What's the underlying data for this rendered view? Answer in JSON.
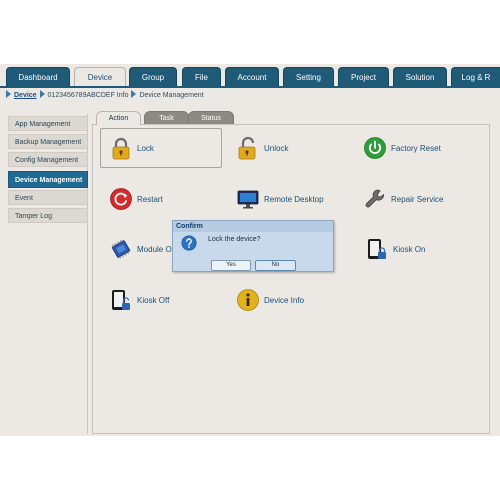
{
  "nav": {
    "tabs": [
      {
        "label": "Dashboard",
        "active": false
      },
      {
        "label": "Device",
        "active": true
      },
      {
        "label": "Group",
        "active": false
      },
      {
        "label": "File",
        "active": false
      },
      {
        "label": "Account",
        "active": false
      },
      {
        "label": "Setting",
        "active": false
      },
      {
        "label": "Project",
        "active": false
      },
      {
        "label": "Solution",
        "active": false
      },
      {
        "label": "Log & R",
        "active": false
      }
    ]
  },
  "breadcrumb": {
    "items": [
      "Device",
      "0123456789ABCDEF Info",
      "Device Management"
    ]
  },
  "sidebar": {
    "items": [
      {
        "label": "App Management",
        "active": false
      },
      {
        "label": "Backup Management",
        "active": false
      },
      {
        "label": "Config Management",
        "active": false
      },
      {
        "label": "Device Management",
        "active": true
      },
      {
        "label": "Event",
        "active": false
      },
      {
        "label": "Tamper Log",
        "active": false
      }
    ]
  },
  "subtabs": [
    {
      "label": "Action",
      "active": true
    },
    {
      "label": "Task",
      "active": false
    },
    {
      "label": "Status",
      "active": false
    }
  ],
  "actions": [
    {
      "label": "Lock",
      "icon": "padlock-closed-icon"
    },
    {
      "label": "Unlock",
      "icon": "padlock-open-icon"
    },
    {
      "label": "Factory Reset",
      "icon": "power-icon"
    },
    {
      "label": "Restart",
      "icon": "restart-icon"
    },
    {
      "label": "Remote Desktop",
      "icon": "monitor-icon"
    },
    {
      "label": "Repair Service",
      "icon": "wrench-icon"
    },
    {
      "label": "Module On",
      "icon": "chip-icon"
    },
    {
      "label": "Kiosk On",
      "icon": "kiosk-lock-icon"
    },
    {
      "label": "Kiosk Off",
      "icon": "kiosk-unlock-icon"
    },
    {
      "label": "Device Info",
      "icon": "info-icon"
    }
  ],
  "dialog": {
    "title": "Confirm",
    "message": "Lock the device?",
    "yes_label": "Yes",
    "no_label": "No"
  },
  "colors": {
    "nav_bg": "#1f5a76",
    "sidebar_active": "#1f6b94",
    "dialog_bg": "#c7d9ea",
    "link_text": "#1b4f78"
  }
}
